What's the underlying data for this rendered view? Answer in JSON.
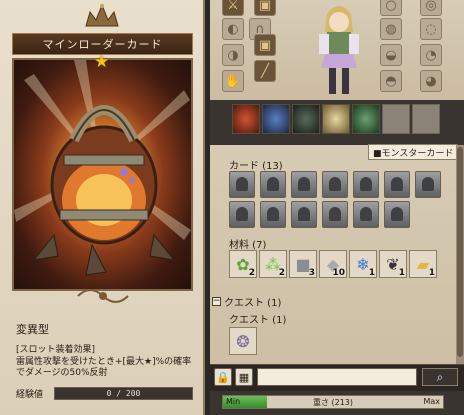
{
  "card_panel": {
    "title": "マインローダーカード",
    "rarity_star": "★",
    "monster_type": "変異型",
    "effect_lines": [
      "[スロット装着効果]",
      "雷属性攻撃を受けたとき+[最大★]%の確率",
      "でダメージの50%反射"
    ],
    "exp_label": "経験値",
    "exp_value": "0 / 200",
    "exp_progress": 0
  },
  "inventory": {
    "monster_tab": "■モンスターカード",
    "cards_label": "カード (13)",
    "card_count_shown": 13,
    "materials_label": "材料 (7)",
    "materials": [
      {
        "icon": "green-pod-icon",
        "count": "2"
      },
      {
        "icon": "herb-bundle-icon",
        "count": "2"
      },
      {
        "icon": "stone-block-icon",
        "count": "3"
      },
      {
        "icon": "gray-ore-icon",
        "count": "10"
      },
      {
        "icon": "blue-crystal-icon",
        "count": "1"
      },
      {
        "icon": "dark-leaf-icon",
        "count": "1"
      },
      {
        "icon": "gold-ingot-icon",
        "count": "1"
      }
    ],
    "quest_header": "クエスト (1)",
    "quest_sub_label": "クエスト (1)",
    "lock_icon": "lock-icon",
    "grid_icon": "grid-icon",
    "search_icon": "magnifier-icon",
    "search_value": ""
  },
  "weight": {
    "min_label": "Min",
    "label": "重さ (213)",
    "max_label": "Max",
    "fill_fraction": 0.2
  },
  "colors": {
    "panel_bg": "#dccfb8",
    "title_bar": "#3a2414",
    "star": "#f3c21b",
    "weight_fill": "#3a8a2c"
  }
}
